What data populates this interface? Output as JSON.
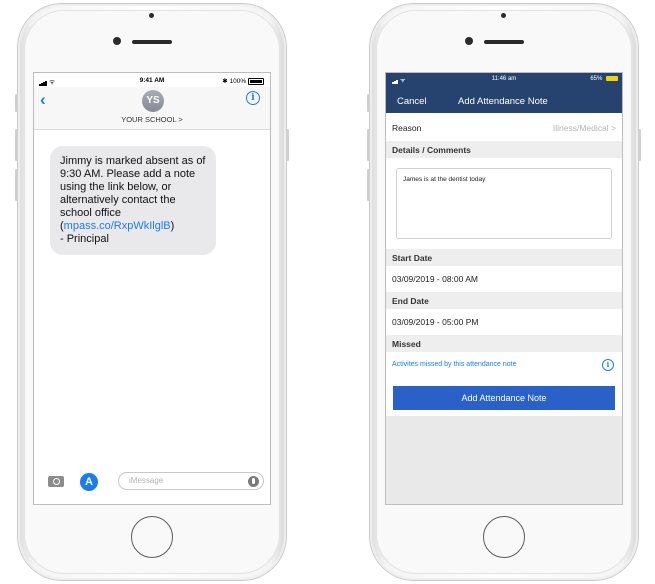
{
  "left_phone": {
    "status": {
      "time": "9:41 AM",
      "battery": "100%"
    },
    "header": {
      "avatar_initials": "YS",
      "contact_name": "YOUR SCHOOL >"
    },
    "message": {
      "text_before_link": "Jimmy is marked absent as of 9:30 AM. Please add a note using the link below, or alternatively contact the school office (",
      "link": "mpass.co/RxpWkIlglB",
      "text_after_link": ")",
      "signature": "- Principal"
    },
    "compose": {
      "placeholder": "iMessage"
    }
  },
  "right_phone": {
    "status": {
      "time": "11:46 am",
      "battery": "65%"
    },
    "nav": {
      "cancel": "Cancel",
      "title": "Add Attendance Note"
    },
    "reason": {
      "label": "Reason",
      "value": "Illness/Medical >"
    },
    "details": {
      "header": "Details / Comments",
      "text": "James is at the dentist today"
    },
    "start_date": {
      "header": "Start Date",
      "value": "03/09/2019 - 08:00 AM"
    },
    "end_date": {
      "header": "End Date",
      "value": "03/09/2019 - 05:00 PM"
    },
    "missed": {
      "header": "Missed",
      "link": "Activites missed by this attendance note"
    },
    "submit_label": "Add Attendance Note"
  }
}
